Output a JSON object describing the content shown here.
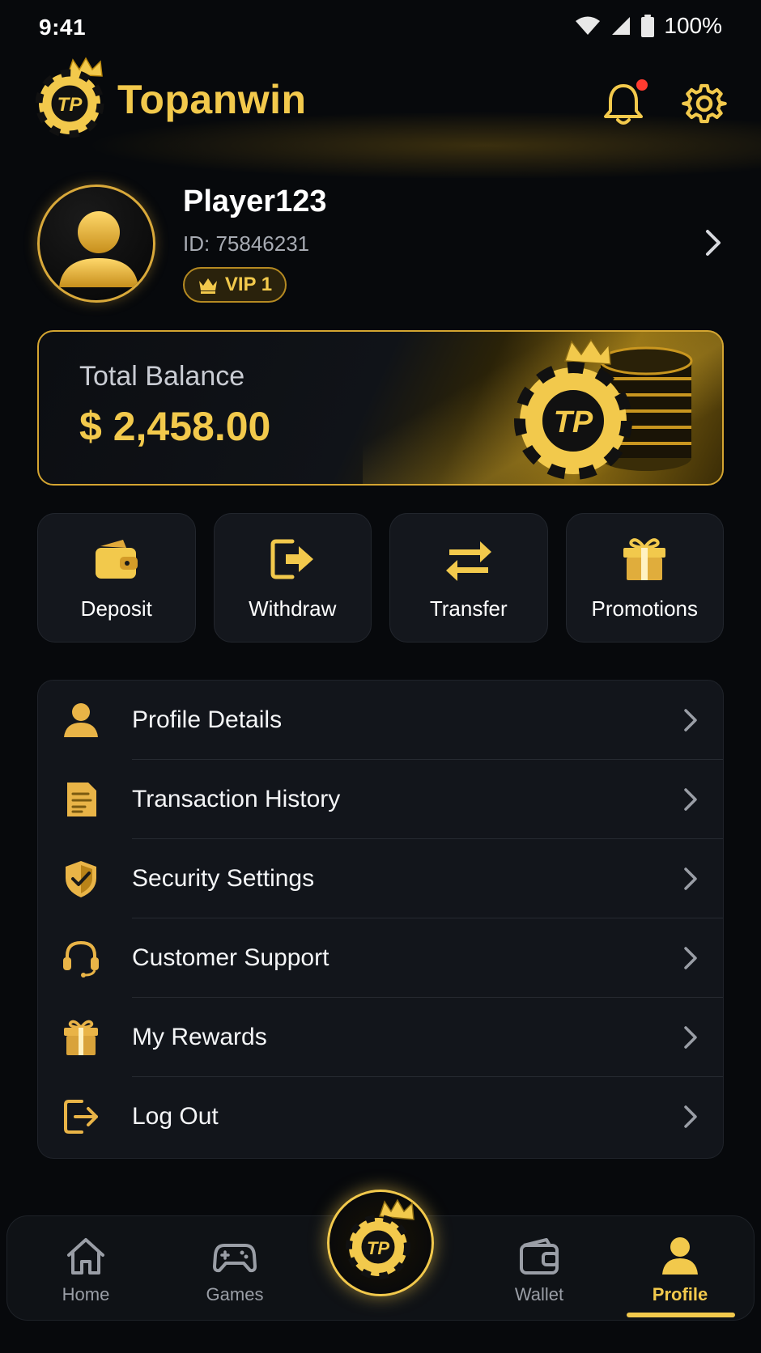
{
  "status_bar": {
    "time": "9:41",
    "battery": "100%"
  },
  "header": {
    "brand": "Topanwin",
    "logo_text": "TP",
    "has_notification": true
  },
  "profile": {
    "username": "Player123",
    "id": "ID: 75846231",
    "vip": "VIP 1"
  },
  "balance": {
    "label": "Total Balance",
    "amount": "$ 2,458.00"
  },
  "actions": [
    {
      "label": "Deposit",
      "icon": "wallet-icon"
    },
    {
      "label": "Withdraw",
      "icon": "withdraw-icon"
    },
    {
      "label": "Transfer",
      "icon": "transfer-icon"
    },
    {
      "label": "Promotions",
      "icon": "gift-icon"
    }
  ],
  "menu": [
    {
      "label": "Profile Details",
      "icon": "user-icon"
    },
    {
      "label": "Transaction History",
      "icon": "document-icon"
    },
    {
      "label": "Security Settings",
      "icon": "shield-icon"
    },
    {
      "label": "Customer Support",
      "icon": "headset-icon"
    },
    {
      "label": "My Rewards",
      "icon": "gift-icon"
    },
    {
      "label": "Log Out",
      "icon": "logout-icon"
    }
  ],
  "nav": [
    {
      "label": "Home",
      "icon": "home-icon"
    },
    {
      "label": "Games",
      "icon": "gamepad-icon"
    },
    {
      "label": "Wallet",
      "icon": "wallet-icon"
    },
    {
      "label": "Profile",
      "icon": "user-icon",
      "active": true
    }
  ],
  "colors": {
    "accent": "#f2c94c",
    "background": "#07090c",
    "card": "#14171d"
  }
}
